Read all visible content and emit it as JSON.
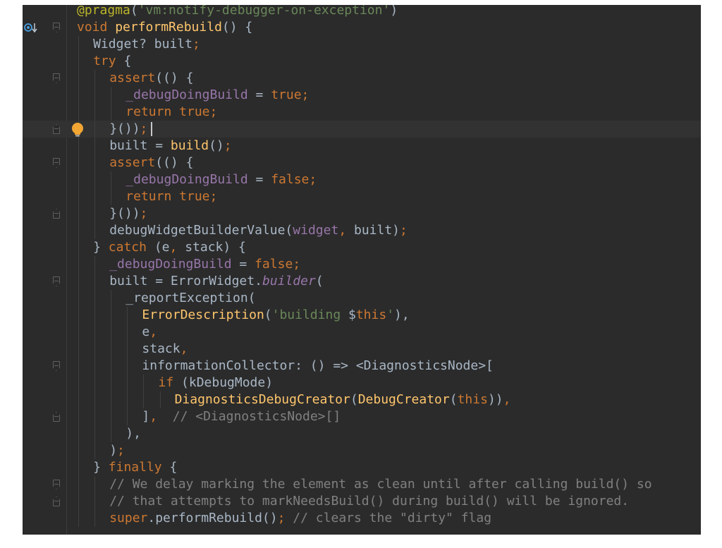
{
  "colors": {
    "editor_bg": "#2b2b2b",
    "current_line": "#323232",
    "default_text": "#a9b7c6",
    "keyword": "#cc7832",
    "function": "#ffc66d",
    "string": "#6a8759",
    "field": "#9876aa",
    "comment": "#808080",
    "annotation": "#bbb529"
  },
  "gutter": {
    "override_icon": "override-method-arrow-icon",
    "intention_icon": "lightbulb-icon"
  },
  "lines": [
    {
      "indent": 0,
      "fold": null,
      "tokens": [
        [
          "ann",
          "@pragma"
        ],
        [
          "",
          "("
        ],
        [
          "str",
          "'vm:notify-debugger-on-exception'"
        ],
        [
          "",
          ")"
        ]
      ]
    },
    {
      "indent": 0,
      "fold": "open",
      "icon": "override",
      "tokens": [
        [
          "kw",
          "void "
        ],
        [
          "fn",
          "performRebuild"
        ],
        [
          "",
          "() {"
        ]
      ]
    },
    {
      "indent": 1,
      "fold": null,
      "tokens": [
        [
          "",
          "Widget? built"
        ],
        [
          "kw",
          ";"
        ]
      ]
    },
    {
      "indent": 1,
      "fold": null,
      "tokens": [
        [
          "kw",
          "try "
        ],
        [
          "",
          "{"
        ]
      ]
    },
    {
      "indent": 2,
      "fold": "open",
      "tokens": [
        [
          "kw",
          "assert"
        ],
        [
          "",
          "(() {"
        ]
      ]
    },
    {
      "indent": 3,
      "fold": null,
      "tokens": [
        [
          "fld",
          "_debugDoingBuild"
        ],
        [
          "",
          " = "
        ],
        [
          "kw",
          "true;"
        ]
      ]
    },
    {
      "indent": 3,
      "fold": null,
      "tokens": [
        [
          "kw",
          "return true;"
        ]
      ]
    },
    {
      "indent": 2,
      "fold": "close",
      "current": true,
      "bulb": true,
      "tokens": [
        [
          "",
          "}())"
        ],
        [
          "kw",
          ";"
        ]
      ]
    },
    {
      "indent": 2,
      "fold": null,
      "tokens": [
        [
          "",
          "built = "
        ],
        [
          "fn",
          "build"
        ],
        [
          "",
          "()"
        ],
        [
          "kw",
          ";"
        ]
      ]
    },
    {
      "indent": 2,
      "fold": "open",
      "tokens": [
        [
          "kw",
          "assert"
        ],
        [
          "",
          "(() {"
        ]
      ]
    },
    {
      "indent": 3,
      "fold": null,
      "tokens": [
        [
          "fld",
          "_debugDoingBuild"
        ],
        [
          "",
          " = "
        ],
        [
          "kw",
          "false;"
        ]
      ]
    },
    {
      "indent": 3,
      "fold": null,
      "tokens": [
        [
          "kw",
          "return true;"
        ]
      ]
    },
    {
      "indent": 2,
      "fold": "close",
      "tokens": [
        [
          "",
          "}())"
        ],
        [
          "kw",
          ";"
        ]
      ]
    },
    {
      "indent": 2,
      "fold": null,
      "tokens": [
        [
          "",
          "debugWidgetBuilderValue("
        ],
        [
          "fld",
          "widget"
        ],
        [
          "kw",
          ", "
        ],
        [
          "",
          "built)"
        ],
        [
          "kw",
          ";"
        ]
      ]
    },
    {
      "indent": 1,
      "fold": null,
      "tokens": [
        [
          "",
          "} "
        ],
        [
          "kw",
          "catch "
        ],
        [
          "",
          "(e"
        ],
        [
          "kw",
          ", "
        ],
        [
          "",
          "stack) {"
        ]
      ]
    },
    {
      "indent": 2,
      "fold": null,
      "tokens": [
        [
          "fld",
          "_debugDoingBuild"
        ],
        [
          "",
          " = "
        ],
        [
          "kw",
          "false;"
        ]
      ]
    },
    {
      "indent": 2,
      "fold": "open",
      "tokens": [
        [
          "",
          "built = ErrorWidget."
        ],
        [
          "fld it",
          "builder"
        ],
        [
          "",
          "("
        ]
      ]
    },
    {
      "indent": 3,
      "fold": null,
      "tokens": [
        [
          "",
          "_reportException("
        ]
      ]
    },
    {
      "indent": 4,
      "fold": null,
      "tokens": [
        [
          "cls",
          "ErrorDescription"
        ],
        [
          "",
          "("
        ],
        [
          "str",
          "'building "
        ],
        [
          "",
          "$"
        ],
        [
          "kw",
          "this"
        ],
        [
          "str",
          "'"
        ],
        [
          "",
          "),"
        ]
      ]
    },
    {
      "indent": 4,
      "fold": null,
      "tokens": [
        [
          "",
          "e"
        ],
        [
          "kw",
          ","
        ]
      ]
    },
    {
      "indent": 4,
      "fold": null,
      "tokens": [
        [
          "",
          "stack"
        ],
        [
          "kw",
          ","
        ]
      ]
    },
    {
      "indent": 4,
      "fold": "open",
      "tokens": [
        [
          "",
          "informationCollector: () => <DiagnosticsNode>["
        ]
      ]
    },
    {
      "indent": 5,
      "fold": null,
      "tokens": [
        [
          "kw",
          "if "
        ],
        [
          "",
          "(kDebugMode)"
        ]
      ]
    },
    {
      "indent": 6,
      "fold": null,
      "tokens": [
        [
          "cls",
          "DiagnosticsDebugCreator"
        ],
        [
          "",
          "("
        ],
        [
          "cls",
          "DebugCreator"
        ],
        [
          "",
          "("
        ],
        [
          "kw",
          "this"
        ],
        [
          "",
          "))"
        ],
        [
          "kw",
          ","
        ]
      ]
    },
    {
      "indent": 4,
      "fold": "close",
      "tokens": [
        [
          "",
          "]"
        ],
        [
          "kw",
          ",  "
        ],
        [
          "com",
          "// <DiagnosticsNode>[]"
        ]
      ]
    },
    {
      "indent": 3,
      "fold": null,
      "tokens": [
        [
          "",
          "),"
        ]
      ]
    },
    {
      "indent": 2,
      "fold": null,
      "tokens": [
        [
          "",
          ")"
        ],
        [
          "kw",
          ";"
        ]
      ]
    },
    {
      "indent": 1,
      "fold": null,
      "tokens": [
        [
          "",
          "} "
        ],
        [
          "kw",
          "finally "
        ],
        [
          "",
          "{"
        ]
      ]
    },
    {
      "indent": 2,
      "fold": "open",
      "tokens": [
        [
          "com",
          "// We delay marking the element as clean until after calling build() so"
        ]
      ]
    },
    {
      "indent": 2,
      "fold": "close",
      "tokens": [
        [
          "com",
          "// that attempts to markNeedsBuild() during build() will be ignored."
        ]
      ]
    },
    {
      "indent": 2,
      "fold": null,
      "tokens": [
        [
          "kw",
          "super"
        ],
        [
          "",
          ".performRebuild()"
        ],
        [
          "kw",
          "; "
        ],
        [
          "com",
          "// clears the \"dirty\" flag"
        ]
      ]
    }
  ]
}
